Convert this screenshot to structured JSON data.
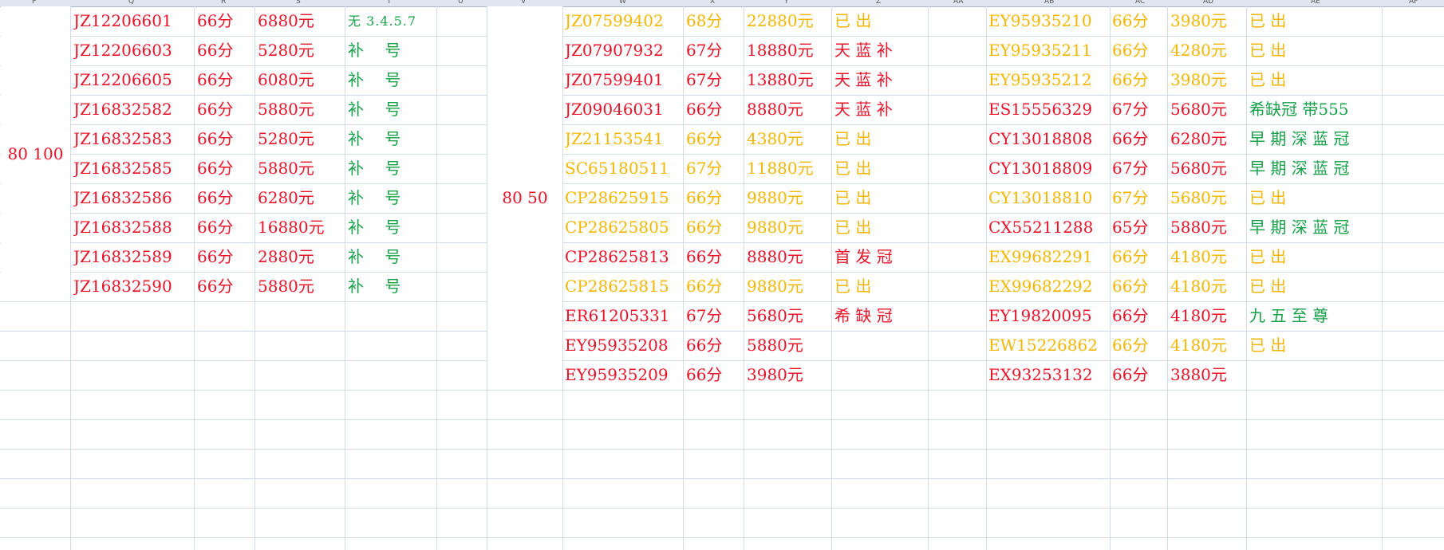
{
  "column_headers": [
    "P",
    "Q",
    "R",
    "S",
    "T",
    "U",
    "V",
    "W",
    "X",
    "Y",
    "Z",
    "AA",
    "AB",
    "AC",
    "AD",
    "AE",
    "AF"
  ],
  "merged_labels": {
    "left": "80 100",
    "middle": "80 50"
  },
  "block1": [
    {
      "code": "JZ12206601",
      "score": "66分",
      "price": "6880元",
      "note": "无 3.4.5.7",
      "color": "red",
      "note_color": "green"
    },
    {
      "code": "JZ12206603",
      "score": "66分",
      "price": "5280元",
      "note": "补　 号",
      "color": "red",
      "note_color": "green"
    },
    {
      "code": "JZ12206605",
      "score": "66分",
      "price": "6080元",
      "note": "补　 号",
      "color": "red",
      "note_color": "green"
    },
    {
      "code": "JZ16832582",
      "score": "66分",
      "price": "5880元",
      "note": "补　 号",
      "color": "red",
      "note_color": "green"
    },
    {
      "code": "JZ16832583",
      "score": "66分",
      "price": "5280元",
      "note": "补　 号",
      "color": "red",
      "note_color": "green"
    },
    {
      "code": "JZ16832585",
      "score": "66分",
      "price": "5880元",
      "note": "补　 号",
      "color": "red",
      "note_color": "green"
    },
    {
      "code": "JZ16832586",
      "score": "66分",
      "price": "6280元",
      "note": "补　 号",
      "color": "red",
      "note_color": "green"
    },
    {
      "code": "JZ16832588",
      "score": "66分",
      "price": "16880元",
      "note": "补　 号",
      "color": "red",
      "note_color": "green"
    },
    {
      "code": "JZ16832589",
      "score": "66分",
      "price": "2880元",
      "note": "补　 号",
      "color": "red",
      "note_color": "green"
    },
    {
      "code": "JZ16832590",
      "score": "66分",
      "price": "5880元",
      "note": "补　 号",
      "color": "red",
      "note_color": "green"
    }
  ],
  "block2": [
    {
      "code": "JZ07599402",
      "score": "68分",
      "price": "22880元",
      "note": "已 出",
      "color": "amber",
      "note_color": "amber"
    },
    {
      "code": "JZ07907932",
      "score": "67分",
      "price": "18880元",
      "note": "天 蓝 补",
      "color": "red",
      "note_color": "red"
    },
    {
      "code": "JZ07599401",
      "score": "67分",
      "price": "13880元",
      "note": "天 蓝 补",
      "color": "red",
      "note_color": "red"
    },
    {
      "code": "JZ09046031",
      "score": "66分",
      "price": "8880元",
      "note": "天 蓝 补",
      "color": "red",
      "note_color": "red"
    },
    {
      "code": "JZ21153541",
      "score": "66分",
      "price": "4380元",
      "note": "已 出",
      "color": "amber",
      "note_color": "amber"
    },
    {
      "code": "SC65180511",
      "score": "67分",
      "price": "11880元",
      "note": "已 出",
      "color": "amber",
      "note_color": "amber"
    },
    {
      "code": "CP28625915",
      "score": "66分",
      "price": "9880元",
      "note": "已 出",
      "color": "amber",
      "note_color": "amber"
    },
    {
      "code": "CP28625805",
      "score": "66分",
      "price": "9880元",
      "note": "已 出",
      "color": "amber",
      "note_color": "amber"
    },
    {
      "code": "CP28625813",
      "score": "66分",
      "price": "8880元",
      "note": "首 发 冠",
      "color": "red",
      "note_color": "red"
    },
    {
      "code": "CP28625815",
      "score": "66分",
      "price": "9880元",
      "note": "已 出",
      "color": "amber",
      "note_color": "amber"
    },
    {
      "code": "ER61205331",
      "score": "67分",
      "price": "5680元",
      "note": "希 缺 冠",
      "color": "red",
      "note_color": "red"
    },
    {
      "code": "EY95935208",
      "score": "66分",
      "price": "5880元",
      "note": "",
      "color": "red",
      "note_color": "red"
    },
    {
      "code": "EY95935209",
      "score": "66分",
      "price": "3980元",
      "note": "",
      "color": "red",
      "note_color": "red"
    }
  ],
  "block3": [
    {
      "code": "EY95935210",
      "score": "66分",
      "price": "3980元",
      "note": "已 出",
      "color": "amber",
      "note_color": "amber"
    },
    {
      "code": "EY95935211",
      "score": "66分",
      "price": "4280元",
      "note": "已 出",
      "color": "amber",
      "note_color": "amber"
    },
    {
      "code": "EY95935212",
      "score": "66分",
      "price": "3980元",
      "note": "已 出",
      "color": "amber",
      "note_color": "amber"
    },
    {
      "code": "ES15556329",
      "score": "67分",
      "price": "5680元",
      "note": "希缺冠 带555",
      "color": "red",
      "note_color": "green"
    },
    {
      "code": "CY13018808",
      "score": "66分",
      "price": "6280元",
      "note": "早 期 深 蓝 冠",
      "color": "red",
      "note_color": "green"
    },
    {
      "code": "CY13018809",
      "score": "67分",
      "price": "5680元",
      "note": "早 期 深 蓝 冠",
      "color": "red",
      "note_color": "green"
    },
    {
      "code": "CY13018810",
      "score": "67分",
      "price": "5680元",
      "note": "已 出",
      "color": "amber",
      "note_color": "amber"
    },
    {
      "code": "CX55211288",
      "score": "65分",
      "price": "5880元",
      "note": "早 期 深 蓝 冠",
      "color": "red",
      "note_color": "green"
    },
    {
      "code": "EX99682291",
      "score": "66分",
      "price": "4180元",
      "note": "已 出",
      "color": "amber",
      "note_color": "amber"
    },
    {
      "code": "EX99682292",
      "score": "66分",
      "price": "4180元",
      "note": "已 出",
      "color": "amber",
      "note_color": "amber"
    },
    {
      "code": "EY19820095",
      "score": "66分",
      "price": "4180元",
      "note": "九 五 至 尊",
      "color": "red",
      "note_color": "green"
    },
    {
      "code": "EW15226862",
      "score": "66分",
      "price": "4180元",
      "note": "已 出",
      "color": "amber",
      "note_color": "amber"
    },
    {
      "code": "EX93253132",
      "score": "66分",
      "price": "3880元",
      "note": "",
      "color": "red",
      "note_color": "red"
    }
  ]
}
